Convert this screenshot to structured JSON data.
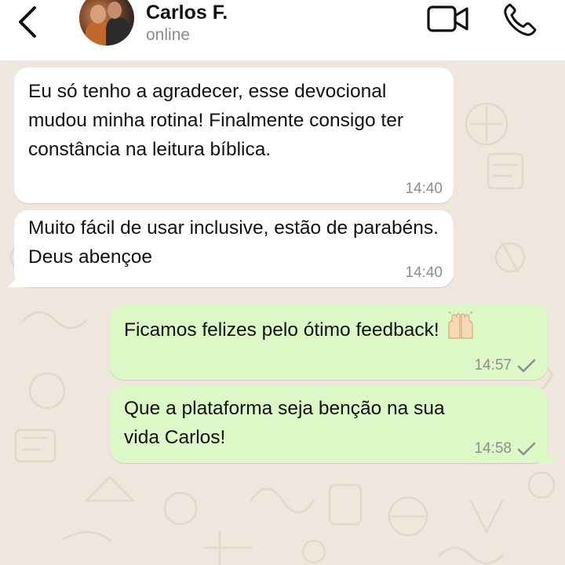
{
  "header": {
    "back_icon": "chevron-left-icon",
    "contact_name": "Carlos F.",
    "contact_status": "online",
    "video_icon": "video-camera-icon",
    "call_icon": "phone-icon"
  },
  "messages": [
    {
      "direction": "incoming",
      "text": "Eu só tenho a agradecer, esse devocional mudou minha rotina! Finalmente consigo ter constância na leitura bíblica.",
      "time": "14:40"
    },
    {
      "direction": "incoming",
      "text": "Muito fácil de usar inclusive, estão de parabéns. Deus abençoe",
      "time": "14:40"
    },
    {
      "direction": "outgoing",
      "text": "Ficamos felizes pelo ótimo feedback!",
      "emoji": "raising-hands-emoji",
      "time": "14:57",
      "status": "sent-check"
    },
    {
      "direction": "outgoing",
      "text": "Que a plataforma seja benção na sua vida Carlos!",
      "time": "14:58",
      "status": "sent-check"
    }
  ],
  "colors": {
    "chat_background": "#efe7dd",
    "incoming_bubble": "#ffffff",
    "outgoing_bubble": "#dcf8c6",
    "timestamp": "#8e8e8e"
  }
}
